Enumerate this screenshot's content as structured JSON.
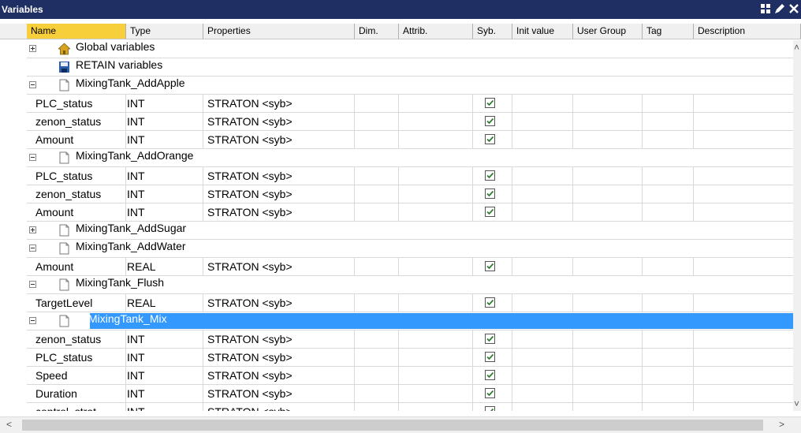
{
  "window": {
    "title": "Variables"
  },
  "columns": [
    {
      "key": "name",
      "label": "Name"
    },
    {
      "key": "type",
      "label": "Type"
    },
    {
      "key": "properties",
      "label": "Properties"
    },
    {
      "key": "dim",
      "label": "Dim."
    },
    {
      "key": "attrib",
      "label": "Attrib."
    },
    {
      "key": "syb",
      "label": "Syb."
    },
    {
      "key": "init",
      "label": "Init value"
    },
    {
      "key": "usergroup",
      "label": "User Group"
    },
    {
      "key": "tag",
      "label": "Tag"
    },
    {
      "key": "desc",
      "label": "Description"
    }
  ],
  "rows": [
    {
      "kind": "group",
      "label": "Global variables",
      "icon": "home-icon",
      "expander": "plus"
    },
    {
      "kind": "group",
      "label": "RETAIN variables",
      "icon": "save-icon",
      "expander": "none"
    },
    {
      "kind": "group",
      "label": "MixingTank_AddApple",
      "icon": "document-icon",
      "expander": "minus"
    },
    {
      "kind": "var",
      "name": "PLC_status",
      "type": "INT",
      "properties": "STRATON <syb>",
      "syb": true
    },
    {
      "kind": "var",
      "name": "zenon_status",
      "type": "INT",
      "properties": "STRATON <syb>",
      "syb": true
    },
    {
      "kind": "var",
      "name": "Amount",
      "type": "INT",
      "properties": "STRATON <syb>",
      "syb": true
    },
    {
      "kind": "group",
      "label": "MixingTank_AddOrange",
      "icon": "document-icon",
      "expander": "minus"
    },
    {
      "kind": "var",
      "name": "PLC_status",
      "type": "INT",
      "properties": "STRATON <syb>",
      "syb": true
    },
    {
      "kind": "var",
      "name": "zenon_status",
      "type": "INT",
      "properties": "STRATON <syb>",
      "syb": true
    },
    {
      "kind": "var",
      "name": "Amount",
      "type": "INT",
      "properties": "STRATON <syb>",
      "syb": true
    },
    {
      "kind": "group",
      "label": "MixingTank_AddSugar",
      "icon": "document-icon",
      "expander": "plus"
    },
    {
      "kind": "group",
      "label": "MixingTank_AddWater",
      "icon": "document-icon",
      "expander": "minus"
    },
    {
      "kind": "var",
      "name": "Amount",
      "type": "REAL",
      "properties": "STRATON <syb>",
      "syb": true
    },
    {
      "kind": "group",
      "label": "MixingTank_Flush",
      "icon": "document-icon",
      "expander": "minus"
    },
    {
      "kind": "var",
      "name": "TargetLevel",
      "type": "REAL",
      "properties": "STRATON <syb>",
      "syb": true
    },
    {
      "kind": "group",
      "label": "MixingTank_Mix",
      "icon": "document-icon",
      "expander": "minus",
      "selected": true
    },
    {
      "kind": "var",
      "name": "zenon_status",
      "type": "INT",
      "properties": "STRATON <syb>",
      "syb": true
    },
    {
      "kind": "var",
      "name": "PLC_status",
      "type": "INT",
      "properties": "STRATON <syb>",
      "syb": true
    },
    {
      "kind": "var",
      "name": "Speed",
      "type": "INT",
      "properties": "STRATON <syb>",
      "syb": true
    },
    {
      "kind": "var",
      "name": "Duration",
      "type": "INT",
      "properties": "STRATON <syb>",
      "syb": true
    },
    {
      "kind": "var",
      "name": "control_strat",
      "type": "INT",
      "properties": "STRATON <syb>",
      "syb": true
    }
  ],
  "colors": {
    "titlebar": "#1f2f63",
    "selection": "#3399ff",
    "name_header": "#f7cf3b",
    "check": "#2e7d32"
  }
}
